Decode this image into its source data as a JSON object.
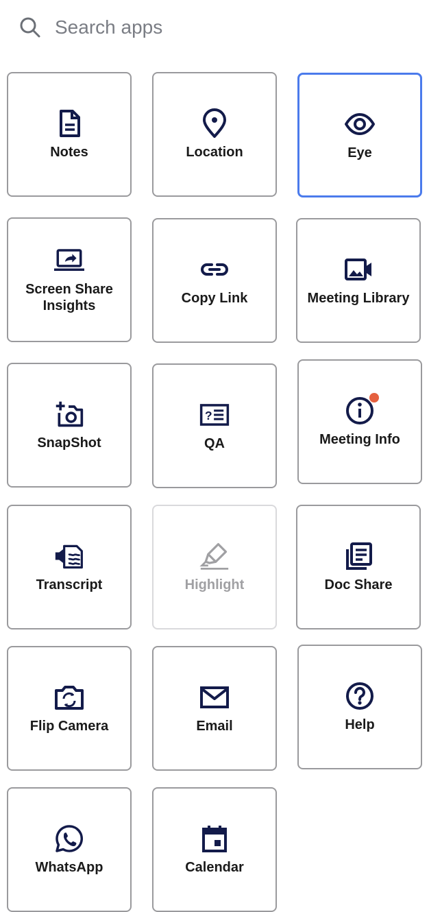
{
  "search": {
    "placeholder": "Search apps",
    "icon": "search-icon"
  },
  "colors": {
    "icon": "#131b4a",
    "selected_border": "#4b7bec",
    "badge": "#e5603f",
    "disabled": "#a0a0a3"
  },
  "apps": [
    {
      "label": "Notes",
      "icon": "notes-icon"
    },
    {
      "label": "Location",
      "icon": "location-pin-icon"
    },
    {
      "label": "Eye",
      "icon": "eye-icon",
      "selected": true
    },
    {
      "label": "Screen Share Insights",
      "icon": "screen-share-icon"
    },
    {
      "label": "Copy Link",
      "icon": "link-icon"
    },
    {
      "label": "Meeting Library",
      "icon": "video-library-icon"
    },
    {
      "label": "SnapShot",
      "icon": "add-camera-icon"
    },
    {
      "label": "QA",
      "icon": "qa-icon"
    },
    {
      "label": "Meeting Info",
      "icon": "info-icon",
      "badge": true
    },
    {
      "label": "Transcript",
      "icon": "transcript-icon"
    },
    {
      "label": "Highlight",
      "icon": "highlighter-icon",
      "disabled": true
    },
    {
      "label": "Doc Share",
      "icon": "doc-share-icon"
    },
    {
      "label": "Flip Camera",
      "icon": "flip-camera-icon"
    },
    {
      "label": "Email",
      "icon": "mail-icon"
    },
    {
      "label": "Help",
      "icon": "help-icon"
    },
    {
      "label": "WhatsApp",
      "icon": "whatsapp-icon"
    },
    {
      "label": "Calendar",
      "icon": "calendar-icon"
    }
  ]
}
